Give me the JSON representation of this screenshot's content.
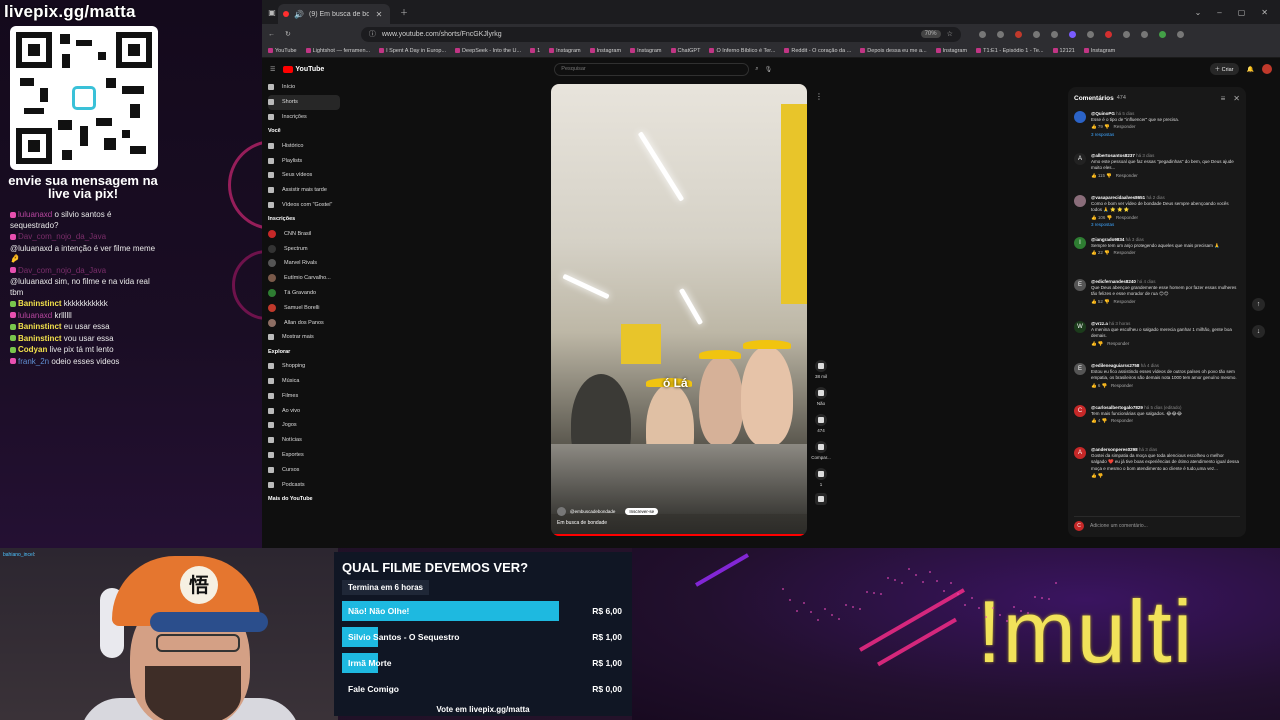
{
  "overlay": {
    "pix_url": "livepix.gg/matta",
    "pix_message": "envie sua mensagem na live via pix!",
    "chat": [
      {
        "user": "luluanaxd",
        "text": "o silvio santos é sequestrado?",
        "user_style": "u-pink"
      },
      {
        "user": "Dav_com_nojo_da_Java",
        "text": "",
        "user_style": "u-dim"
      },
      {
        "user": "",
        "text": "@luluanaxd a intenção é ver filme meme 🤌",
        "user_style": "u-pink"
      },
      {
        "user": "Dav_com_nojo_da_Java",
        "text": "",
        "user_style": "u-dim"
      },
      {
        "user": "",
        "text": "@luluanaxd sim, no filme e na vida real tbm",
        "user_style": "u-pink"
      },
      {
        "user": "Baninstinct",
        "text": "kkkkkkkkkkk",
        "user_style": "u-yellow"
      },
      {
        "user": "luluanaxd",
        "text": "krllllll",
        "user_style": "u-pink"
      },
      {
        "user": "Baninstinct",
        "text": "eu usar essa",
        "user_style": "u-yellow"
      },
      {
        "user": "Baninstinct",
        "text": "vou usar essa",
        "user_style": "u-yellow"
      },
      {
        "user": "Codyan",
        "text": "live pix tá mt lento",
        "user_style": "u-yellow"
      },
      {
        "user": "frank_2n",
        "text": "odeio esses videos",
        "user_style": "u-blue"
      }
    ]
  },
  "browser": {
    "tab_title": "(9) Em busca de bondade",
    "url": "www.youtube.com/shorts/FncGKJlyrkg",
    "zoom": "70%",
    "bookmarks": [
      "YouTube",
      "Lightshot — ferramen...",
      "I Spent A Day in Europ...",
      "DeepSeek - Into the U...",
      "1",
      "Instagram",
      "Instagram",
      "Instagram",
      "ChatGPT",
      "O Inferno Bíblico é Ter...",
      "Reddit - O coração da ...",
      "Depois dessa eu me a...",
      "Instagram",
      "T1:E1 - Episódio 1 - Te...",
      "12121",
      "Instagram"
    ]
  },
  "youtube": {
    "logo": "YouTube",
    "search_placeholder": "Pesquisar",
    "create_label": "Criar",
    "sidebar": {
      "main": [
        "Início",
        "Shorts",
        "Inscrições"
      ],
      "voce_header": "Você",
      "voce": [
        "Histórico",
        "Playlists",
        "Seus vídeos",
        "Assistir mais tarde",
        "Vídeos com \"Gostei\""
      ],
      "subs_header": "Inscrições",
      "subs": [
        "CNN Brasil",
        "Spectrum",
        "Marvel Rivals",
        "Eutímio Carvalho...",
        "Tá Gravando",
        "Samuel Borelli",
        "Allan dos Panos",
        "Mostrar mais"
      ],
      "explore_header": "Explorar",
      "explore": [
        "Shopping",
        "Música",
        "Filmes",
        "Ao vivo",
        "Jogos",
        "Notícias",
        "Esportes",
        "Cursos",
        "Podcasts"
      ],
      "more_header": "Mais do YouTube"
    },
    "video": {
      "caption": "ó Lá",
      "channel": "@embuscadebondade",
      "subscribe": "Inscrever-se",
      "title": "Em busca de bondade",
      "progress_pct": 100
    },
    "actions": {
      "likes": "38 mil",
      "dislike": "Não",
      "comments": "474",
      "share": "Compar...",
      "remix": "1"
    },
    "comments": {
      "title": "Comentários",
      "count": "474",
      "add_placeholder": "Adicione um comentário...",
      "items": [
        {
          "user": "@QuinoPG",
          "time": "há 5 dias",
          "text": "Esse é o tipo de \"influencer\" que se precisa.",
          "likes": "79",
          "reply_label": "Responder",
          "replies": "3 respostas",
          "color": "#2b63c7",
          "initial": ""
        },
        {
          "user": "@albertosantos8237",
          "time": "há 3 dias",
          "text": "Amo este pessoal que faz essas \"pegadinhas\" do bem, que Deus ajude muito eles...",
          "likes": "115",
          "reply_label": "Responder",
          "replies": "",
          "color": "#222",
          "initial": "A"
        },
        {
          "user": "@vasaparecidaalves8651",
          "time": "há 2 dias",
          "text": "Como e bom ver vídeo de bondade Deus sempre abençoando vocês todos 🙏 ⭐ ⭐ ⭐",
          "likes": "106",
          "reply_label": "Responder",
          "replies": "3 respostas",
          "color": "#8a6d7a",
          "initial": ""
        },
        {
          "user": "@iangrado9834",
          "time": "há 3 dias",
          "text": "Sempre tem um anjo protegendo aqueles que mais precisam 🙏",
          "likes": "22",
          "reply_label": "Responder",
          "replies": "",
          "color": "#2e7d32",
          "initial": "I"
        },
        {
          "user": "@edicfernandes8240",
          "time": "há 4 dias",
          "text": "Que Deus abençoe grandemente esse homem por fazer essas mulheres tão felizes e esse morador de rua 😊😊",
          "likes": "52",
          "reply_label": "Responder",
          "replies": "",
          "color": "#555",
          "initial": "E"
        },
        {
          "user": "@vrzz.a",
          "time": "há 3 horas",
          "text": "A menina que escolheu o salgado merecia ganhar 1 milhão, gente boa demais.",
          "likes": "",
          "reply_label": "Responder",
          "replies": "",
          "color": "#1b3b1b",
          "initial": "W"
        },
        {
          "user": "@edileneaguiarss2758",
          "time": "há 4 dias",
          "text": "Estou eu fico assistindo esses vídeos de outros países oh povo tão sem empatia, os brasileiros são demais nota 1000 tem amor genuíno mesmo.",
          "likes": "6",
          "reply_label": "Responder",
          "replies": "",
          "color": "#555",
          "initial": "E"
        },
        {
          "user": "@carlosalbertogalo7829",
          "time": "há 5 dias (editado)",
          "text": "Tem mais funcionárias que salgados. 😂😂😂",
          "likes": "4",
          "reply_label": "Responder",
          "replies": "",
          "color": "#c62828",
          "initial": "C"
        },
        {
          "user": "@andersonperes0298",
          "time": "há 3 dias",
          "text": "Gostei da simpatia da moça que toda alencious escolheu o melhor salgado ❤️ eu já tive boas experiências de ótimo atendimento igual dessa moça e mesmo o bom atendimento ao cliente é tudo,uma vez...",
          "likes": "",
          "reply_label": "",
          "replies": "",
          "color": "#c62828",
          "initial": "A"
        }
      ]
    }
  },
  "poll": {
    "title": "QUAL FILME DEVEMOS VER?",
    "time": "Termina em 6 horas",
    "options": [
      {
        "label": "Não! Não Olhe!",
        "value": "R$ 6,00",
        "fill_pct": 100
      },
      {
        "label": "Silvio Santos - O Sequestro",
        "value": "R$ 1,00",
        "fill_pct": 16.7
      },
      {
        "label": "Irmã Morte",
        "value": "R$ 1,00",
        "fill_pct": 16.7
      },
      {
        "label": "Fale Comigo",
        "value": "R$ 0,00",
        "fill_pct": 0
      }
    ],
    "footer": "Vote em livepix.gg/matta"
  },
  "webcam": {
    "user": "bahiano_incel",
    "cap_logo": "悟"
  },
  "command": "!multi"
}
